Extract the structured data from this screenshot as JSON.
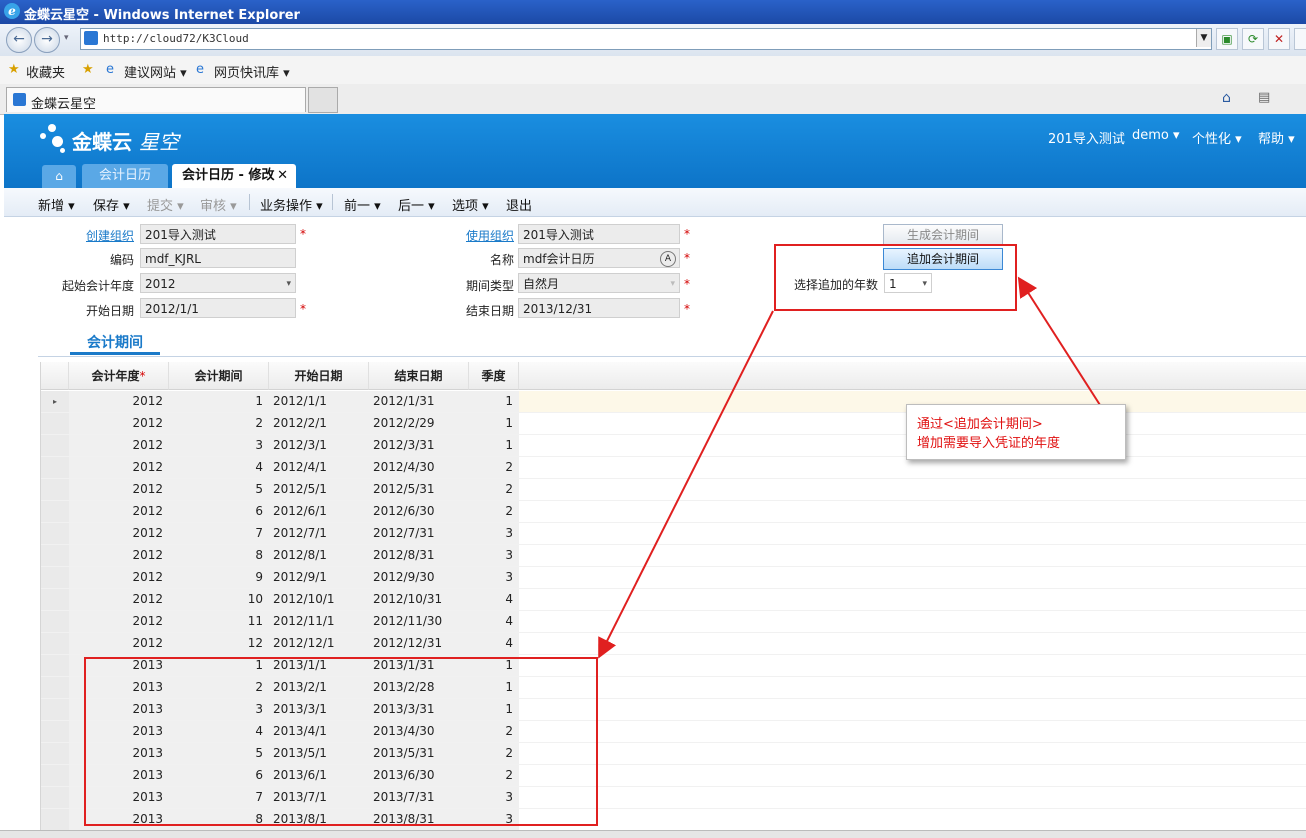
{
  "browser": {
    "title": "金蝶云星空 - Windows Internet Explorer",
    "address": "http://cloud72/K3Cloud",
    "favorites_label": "收藏夹",
    "fav_items": [
      "建议网站 ▾",
      "网页快讯库 ▾"
    ],
    "tab_title": "金蝶云星空"
  },
  "app": {
    "logo_a": "金蝶云",
    "logo_b": "星空",
    "org_menu": "201导入测试",
    "user_menu": "demo ▾",
    "personalize_menu": "个性化 ▾",
    "help_menu": "帮助 ▾",
    "tabs": [
      "会计日历",
      "会计日历 - 修改"
    ],
    "close_glyph": "✕",
    "home_glyph": "⌂"
  },
  "toolbar": {
    "items": [
      "新增 ▾",
      "保存 ▾",
      "提交 ▾",
      "审核 ▾",
      "业务操作 ▾",
      "前一 ▾",
      "后一 ▾",
      "选项 ▾",
      "退出"
    ]
  },
  "form": {
    "create_org_label": "创建组织",
    "create_org_value": "201导入测试",
    "code_label": "编码",
    "code_value": "mdf_KJRL",
    "start_year_label": "起始会计年度",
    "start_year_value": "2012",
    "start_date_label": "开始日期",
    "start_date_value": "2012/1/1",
    "use_org_label": "使用组织",
    "use_org_value": "201导入测试",
    "name_label": "名称",
    "name_value": "mdf会计日历",
    "period_type_label": "期间类型",
    "period_type_value": "自然月",
    "end_date_label": "结束日期",
    "end_date_value": "2013/12/31",
    "required_mark": "*",
    "generate_btn": "生成会计期间",
    "append_btn": "追加会计期间",
    "append_years_label": "选择追加的年数",
    "append_years_value": "1",
    "lang_glyph": "A",
    "arrow": "▾"
  },
  "section": {
    "title": "会计期间"
  },
  "grid": {
    "columns": [
      "会计年度",
      "会计期间",
      "开始日期",
      "结束日期",
      "季度"
    ],
    "rows": [
      [
        "2012",
        "1",
        "2012/1/1",
        "2012/1/31",
        "1"
      ],
      [
        "2012",
        "2",
        "2012/2/1",
        "2012/2/29",
        "1"
      ],
      [
        "2012",
        "3",
        "2012/3/1",
        "2012/3/31",
        "1"
      ],
      [
        "2012",
        "4",
        "2012/4/1",
        "2012/4/30",
        "2"
      ],
      [
        "2012",
        "5",
        "2012/5/1",
        "2012/5/31",
        "2"
      ],
      [
        "2012",
        "6",
        "2012/6/1",
        "2012/6/30",
        "2"
      ],
      [
        "2012",
        "7",
        "2012/7/1",
        "2012/7/31",
        "3"
      ],
      [
        "2012",
        "8",
        "2012/8/1",
        "2012/8/31",
        "3"
      ],
      [
        "2012",
        "9",
        "2012/9/1",
        "2012/9/30",
        "3"
      ],
      [
        "2012",
        "10",
        "2012/10/1",
        "2012/10/31",
        "4"
      ],
      [
        "2012",
        "11",
        "2012/11/1",
        "2012/11/30",
        "4"
      ],
      [
        "2012",
        "12",
        "2012/12/1",
        "2012/12/31",
        "4"
      ],
      [
        "2013",
        "1",
        "2013/1/1",
        "2013/1/31",
        "1"
      ],
      [
        "2013",
        "2",
        "2013/2/1",
        "2013/2/28",
        "1"
      ],
      [
        "2013",
        "3",
        "2013/3/1",
        "2013/3/31",
        "1"
      ],
      [
        "2013",
        "4",
        "2013/4/1",
        "2013/4/30",
        "2"
      ],
      [
        "2013",
        "5",
        "2013/5/1",
        "2013/5/31",
        "2"
      ],
      [
        "2013",
        "6",
        "2013/6/1",
        "2013/6/30",
        "2"
      ],
      [
        "2013",
        "7",
        "2013/7/1",
        "2013/7/31",
        "3"
      ],
      [
        "2013",
        "8",
        "2013/8/1",
        "2013/8/31",
        "3"
      ]
    ],
    "current_row_marker": "▸"
  },
  "annotation": {
    "line1": "通过<追加会计期间>",
    "line2": "增加需要导入凭证的年度",
    "color": "#e02020"
  }
}
